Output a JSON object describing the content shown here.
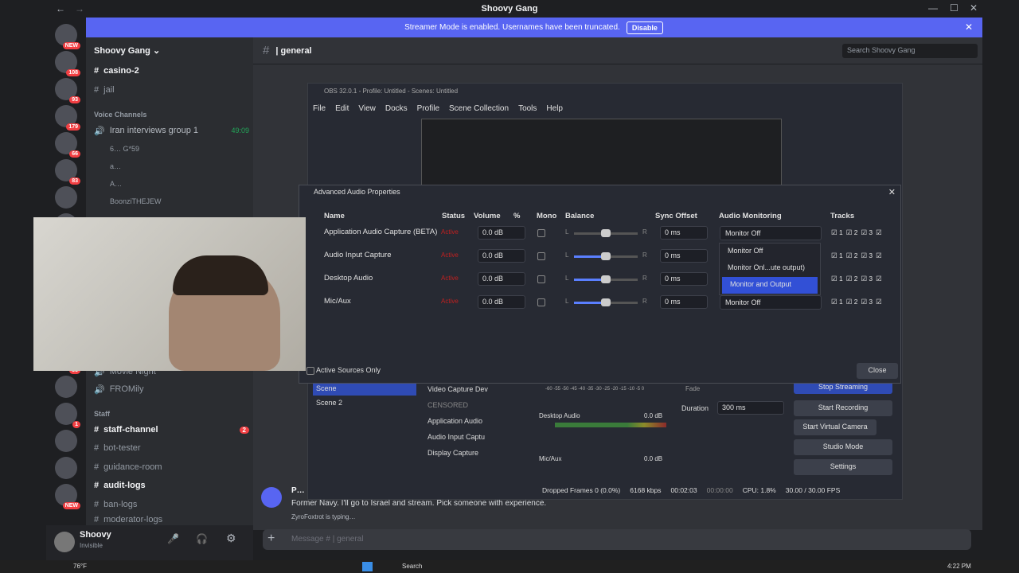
{
  "window": {
    "title": "Shoovy Gang"
  },
  "banner": {
    "text": "Streamer Mode is enabled. Usernames have been truncated.",
    "button": "Disable"
  },
  "server": {
    "name": "Shoovy Gang"
  },
  "channels": {
    "top": [
      {
        "label": "casino-2"
      },
      {
        "label": "jail"
      }
    ],
    "voice_category": "Voice Channels",
    "voice_channel": {
      "label": "Iran interviews group 1",
      "time": "49:09"
    },
    "voice_users": [
      "6…  G*59",
      "a…",
      "A…",
      "BoonziTHEJEW"
    ],
    "lower": [
      {
        "label": "Movie Night"
      },
      {
        "label": "FROMily"
      }
    ],
    "staff_category": "Staff",
    "staff": [
      {
        "label": "staff-channel",
        "badge": "2"
      },
      {
        "label": "bot-tester"
      },
      {
        "label": "guidance-room"
      },
      {
        "label": "audit-logs"
      },
      {
        "label": "ban-logs"
      },
      {
        "label": "moderator-logs"
      }
    ]
  },
  "server_badges": [
    "NEW",
    "108",
    "93",
    "179",
    "66",
    "83",
    "",
    "58",
    "",
    "",
    "19",
    "",
    "33",
    "",
    "1",
    "",
    "",
    "NEW"
  ],
  "header": {
    "channel": "general",
    "search_placeholder": "Search Shoovy Gang"
  },
  "chat": {
    "author": "P…",
    "message": "Former Navy. I'll go to Israel and stream. Pick someone with experience.",
    "typing": "ZyroFoxtrot is typing…",
    "input_placeholder": "Message # | general"
  },
  "user_panel": {
    "name": "Shoovy",
    "status": "Invisible"
  },
  "obs": {
    "title": "OBS 32.0.1 - Profile: Untitled - Scenes: Untitled",
    "menu": [
      "File",
      "Edit",
      "View",
      "Docks",
      "Profile",
      "Scene Collection",
      "Tools",
      "Help"
    ],
    "scene_items": [
      "Scene",
      "Scene 2"
    ],
    "sources": [
      "Video Capture Dev",
      "CENSORED",
      "Application Audio",
      "Audio Input Captu",
      "Display Capture"
    ],
    "mixer": [
      {
        "name": "Desktop Audio",
        "db": "0.0 dB"
      },
      {
        "name": "Mic/Aux",
        "db": "0.0 dB"
      }
    ],
    "meter_scale": "-60 -55 -50 -45 -40 -35 -30 -25 -20 -15 -10 -5 0",
    "transition": {
      "type": "Fade",
      "duration_label": "Duration",
      "duration": "300 ms"
    },
    "controls": [
      "Stop Streaming",
      "Start Recording",
      "Start Virtual Camera",
      "Studio Mode",
      "Settings"
    ],
    "status": {
      "dropped": "Dropped Frames 0 (0.0%)",
      "kbps": "6168 kbps",
      "stream_time": "00:02:03",
      "rec_time": "00:00:00",
      "cpu": "CPU: 1.8%",
      "fps": "30.00 / 30.00 FPS"
    }
  },
  "dialog": {
    "title": "Advanced Audio Properties",
    "columns": {
      "name": "Name",
      "status": "Status",
      "volume": "Volume",
      "pct": "%",
      "mono": "Mono",
      "balance": "Balance",
      "sync": "Sync Offset",
      "monitoring": "Audio Monitoring",
      "tracks": "Tracks"
    },
    "rows": [
      {
        "name": "Application Audio Capture (BETA)",
        "status": "Active",
        "volume": "0.0 dB",
        "sync": "0 ms",
        "monitoring": "Monitor Off"
      },
      {
        "name": "Audio Input Capture",
        "status": "Active",
        "volume": "0.0 dB",
        "sync": "0 ms",
        "monitoring": ""
      },
      {
        "name": "Desktop Audio",
        "status": "Active",
        "volume": "0.0 dB",
        "sync": "0 ms",
        "monitoring": ""
      },
      {
        "name": "Mic/Aux",
        "status": "Active",
        "volume": "0.0 dB",
        "sync": "0 ms",
        "monitoring": "Monitor Off"
      }
    ],
    "balance_l": "L",
    "balance_r": "R",
    "track_labels": [
      "1",
      "2",
      "3"
    ],
    "dropdown_options": [
      "Monitor Off",
      "Monitor Onl...ute output)",
      "Monitor and Output"
    ],
    "dropdown_selected_index": 2,
    "active_sources_label": "Active Sources Only",
    "close": "Close"
  },
  "taskbar": {
    "weather": "76°F",
    "search": "Search",
    "time": "4:22 PM"
  }
}
